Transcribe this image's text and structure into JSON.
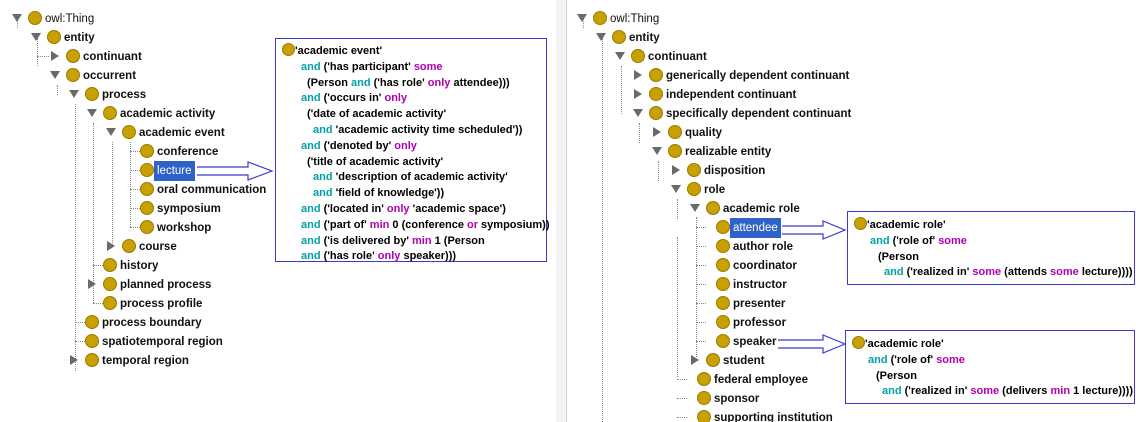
{
  "left_tree": {
    "root": "owl:Thing",
    "entity": "entity",
    "continuant": "continuant",
    "occurrent": "occurrent",
    "process": "process",
    "academic_activity": "academic activity",
    "academic_event": "academic event",
    "conference": "conference",
    "lecture": "lecture",
    "oral_communication": "oral communication",
    "symposium": "symposium",
    "workshop": "workshop",
    "course": "course",
    "history": "history",
    "planned_process": "planned process",
    "process_profile": "process profile",
    "process_boundary": "process boundary",
    "spatiotemporal_region": "spatiotemporal region",
    "temporal_region": "temporal region"
  },
  "right_tree": {
    "root": "owl:Thing",
    "entity": "entity",
    "continuant": "continuant",
    "generically_dependent": "generically dependent continuant",
    "independent": "independent continuant",
    "specifically_dependent": "specifically dependent continuant",
    "quality": "quality",
    "realizable_entity": "realizable entity",
    "disposition": "disposition",
    "role": "role",
    "academic_role": "academic role",
    "attendee": "attendee",
    "author_role": "author role",
    "coordinator": "coordinator",
    "instructor": "instructor",
    "presenter": "presenter",
    "professor": "professor",
    "speaker": "speaker",
    "student": "student",
    "federal_employee": "federal employee",
    "sponsor": "sponsor",
    "supporting_institution": "supporting institution"
  },
  "lecture_box": {
    "l1": "'academic event'",
    "l2a": "and",
    "l2b": " ('has participant' ",
    "l2c": "some",
    "l3a": "(Person ",
    "l3b": "and",
    "l3c": " ('has role' ",
    "l3d": "only",
    "l3e": " attendee)))",
    "l4a": "and",
    "l4b": " ('occurs in' ",
    "l4c": "only",
    "l5": "('date of academic activity'",
    "l6a": "and",
    "l6b": " 'academic activity time scheduled'))",
    "l7a": "and",
    "l7b": " ('denoted by' ",
    "l7c": "only",
    "l8": "('title of academic activity'",
    "l9a": "and",
    "l9b": " 'description of academic activity'",
    "l10a": "and",
    "l10b": " 'field of knowledge'))",
    "l11a": "and",
    "l11b": " ('located in' ",
    "l11c": "only",
    "l11d": " 'academic space')",
    "l12a": "and",
    "l12b": " ('part of' ",
    "l12c": "min",
    "l12d": " 0 (conference ",
    "l12e": "or",
    "l12f": " symposium))",
    "l13a": "and",
    "l13b": " ('is delivered by' ",
    "l13c": "min",
    "l13d": " 1 (Person",
    "l14a": "and",
    "l14b": " ('has role' ",
    "l14c": "only",
    "l14d": " speaker)))"
  },
  "attendee_box": {
    "l1": "'academic role'",
    "l2a": "and",
    "l2b": " ('role of' ",
    "l2c": "some",
    "l3": "(Person",
    "l4a": "and",
    "l4b": " ('realized in' ",
    "l4c": "some",
    "l4d": " (attends ",
    "l4e": "some",
    "l4f": " lecture))))"
  },
  "speaker_box": {
    "l1": "'academic role'",
    "l2a": "and",
    "l2b": " ('role of' ",
    "l2c": "some",
    "l3": "(Person",
    "l4a": "and",
    "l4b": " ('realized in' ",
    "l4c": "some",
    "l4d": " (delivers ",
    "l4e": "min",
    "l4f": " 1 lecture))))"
  },
  "colors": {
    "class_dot": "#c8a000",
    "selection": "#2e62c8",
    "keyword_and": "#00a0a8",
    "keyword_quantifier": "#b000b0",
    "box_border": "#3b3bcc"
  }
}
